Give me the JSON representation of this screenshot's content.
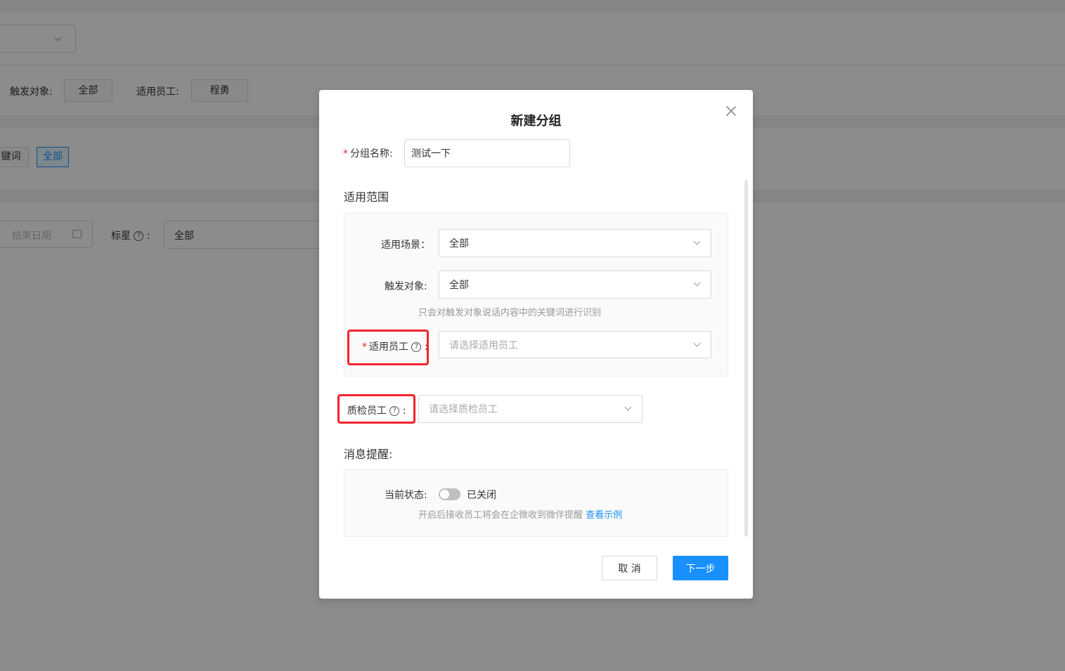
{
  "background": {
    "trigger_label": "触发对象:",
    "trigger_value": "全部",
    "staff_label": "适用员工:",
    "staff_value": "程勇",
    "keyword_tag": "键词",
    "all_tag": "全部",
    "end_date_placeholder": "结束日期",
    "star_label": "标星",
    "star_value": "全部"
  },
  "modal": {
    "title": "新建分组",
    "group_name": {
      "label": "分组名称:",
      "value": "测试一下"
    },
    "scope_title": "适用范围",
    "scene": {
      "label": "适用场景：",
      "value": "全部"
    },
    "trigger": {
      "label": "触发对象:",
      "value": "全部"
    },
    "trigger_hint": "只会对触发对象说话内容中的关键词进行识别",
    "staff": {
      "label": "适用员工",
      "colon": ":",
      "placeholder": "请选择适用员工"
    },
    "inspector": {
      "label": "质检员工",
      "colon": ":",
      "placeholder": "请选择质检员工"
    },
    "notify_title": "消息提醒:",
    "status": {
      "label": "当前状态:",
      "value": "已关闭",
      "on": false
    },
    "notify_hint": "开启后接收员工将会在企微收到微伴提醒",
    "notify_link": "查看示例",
    "cancel_label": "取 消",
    "next_label": "下一步"
  },
  "colors": {
    "primary": "#1890ff",
    "required": "#f5222d",
    "highlight_box": "#f5222d"
  },
  "icons": {
    "close": "close-icon",
    "help": "question-circle-icon",
    "chevron": "chevron-down-icon",
    "calendar": "calendar-icon"
  }
}
